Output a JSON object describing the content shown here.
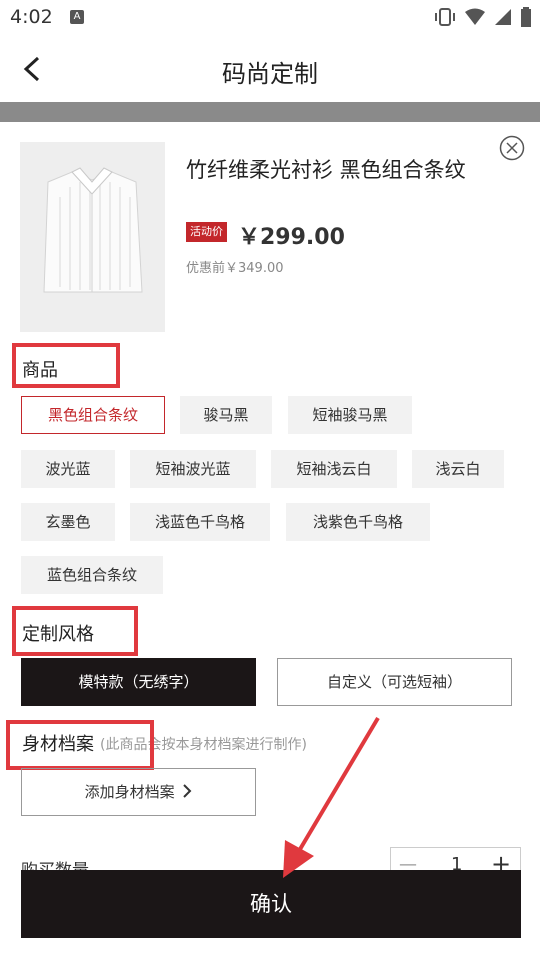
{
  "status": {
    "time": "4:02"
  },
  "nav": {
    "title": "码尚定制"
  },
  "product": {
    "name": "竹纤维柔光衬衫 黑色组合条纹",
    "promo_label": "活动价",
    "price": "￥299.00",
    "original_price": "优惠前￥349.00"
  },
  "sections": {
    "product_label": "商品",
    "style_label": "定制风格",
    "profile_label": "身材档案",
    "profile_hint": "(此商品会按本身材档案进行制作)",
    "quantity_label": "购买数量"
  },
  "colors": [
    "黑色组合条纹",
    "骏马黑",
    "短袖骏马黑",
    "波光蓝",
    "短袖波光蓝",
    "短袖浅云白",
    "浅云白",
    "玄墨色",
    "浅蓝色千鸟格",
    "浅紫色千鸟格",
    "蓝色组合条纹"
  ],
  "styles": [
    "模特款（无绣字）",
    "自定义（可选短袖）"
  ],
  "add_profile_label": "添加身材档案",
  "quantity": {
    "value": "1",
    "minus": "—",
    "plus": "+"
  },
  "confirm_label": "确认",
  "theme": {
    "accent": "#c3272b",
    "dark": "#1b1617",
    "annotation": "#e0393e"
  }
}
